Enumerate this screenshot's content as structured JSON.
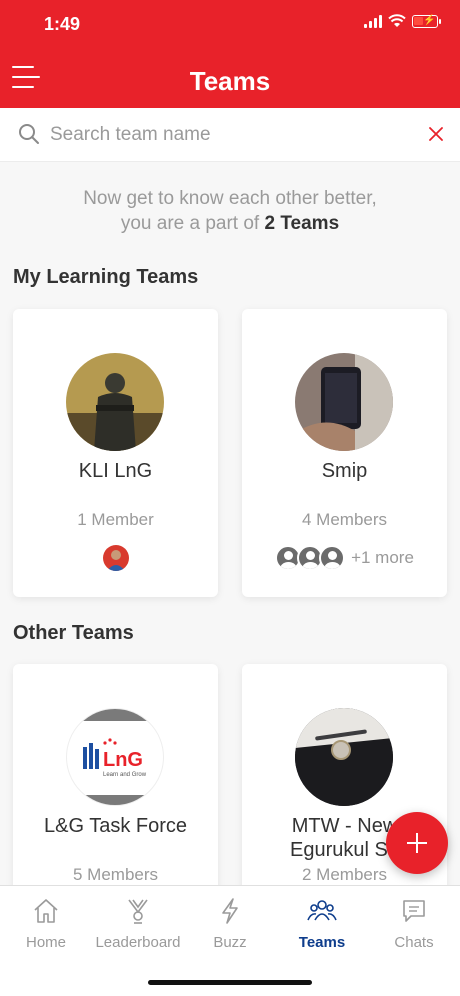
{
  "status_bar": {
    "time": "1:49"
  },
  "header": {
    "title": "Teams"
  },
  "search": {
    "placeholder": "Search team name",
    "value": ""
  },
  "intro": {
    "line1": "Now get to know each other better,",
    "line2_prefix": "you are a part of ",
    "team_count": "2 Teams"
  },
  "my_teams": {
    "title": "My Learning Teams",
    "cards": [
      {
        "name": "KLI LnG",
        "members": "1 Member"
      },
      {
        "name": "Smip",
        "members": "4 Members",
        "more": "+1 more"
      }
    ]
  },
  "other_teams": {
    "title": "Other Teams",
    "cards": [
      {
        "name": "L&G Task Force",
        "members": "5 Members",
        "logo_text": "LnG",
        "logo_tagline": "Learn and Grow"
      },
      {
        "name_line1": "MTW - New",
        "name_line2": "Egurukul Se",
        "members": "2 Members"
      }
    ]
  },
  "tabs": [
    {
      "label": "Home",
      "icon": "home-icon"
    },
    {
      "label": "Leaderboard",
      "icon": "trophy-icon"
    },
    {
      "label": "Buzz",
      "icon": "lightning-icon"
    },
    {
      "label": "Teams",
      "icon": "group-icon",
      "active": true
    },
    {
      "label": "Chats",
      "icon": "chat-icon"
    }
  ],
  "colors": {
    "brand": "#e8222a",
    "active_tab": "#0e3d8c",
    "muted_text": "#9a9a9a"
  }
}
